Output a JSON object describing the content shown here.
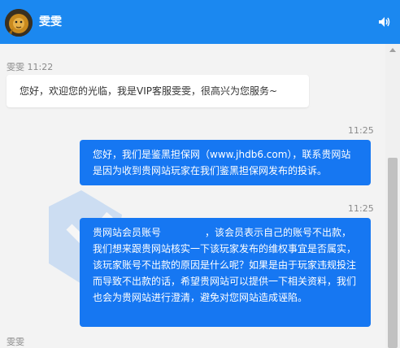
{
  "header": {
    "agent_name": "雯雯",
    "avatar_icon": "lion-avatar-icon",
    "sound_icon": "speaker-icon",
    "background": "#1b88f0"
  },
  "messages": [
    {
      "direction": "incoming",
      "sender": "雯雯 11:22",
      "text": "您好，欢迎您的光临，我是VIP客服雯雯，很高兴为您服务~"
    },
    {
      "direction": "outgoing",
      "time": "11:25",
      "text": "您好，我们是鉴黑担保网（www.jhdb6.com），联系贵网站是因为收到贵网站玩家在我们鉴黑担保网发布的投诉。"
    },
    {
      "direction": "outgoing",
      "time": "11:25",
      "text_before": "贵网站会员账号",
      "text_after": "，该会员表示自己的账号不出款，我们想来跟贵网站核实一下该玩家发布的维权事宜是否属实，该玩家账号不出款的原因是什么呢？如果是由于玩家违规投注而导致不出款的话，希望贵网站可以提供一下相关资料，我们也会为贵网站进行澄清，避免对您网站造成诬陷。"
    }
  ],
  "footer": {
    "sender": "雯雯"
  },
  "watermark": {
    "text": "鉴黑担保网",
    "url": "www.jhdb6.com"
  },
  "colors": {
    "outgoing_bubble": "#1677f2",
    "incoming_bubble": "#ffffff",
    "chat_background": "#f3f3f3"
  }
}
